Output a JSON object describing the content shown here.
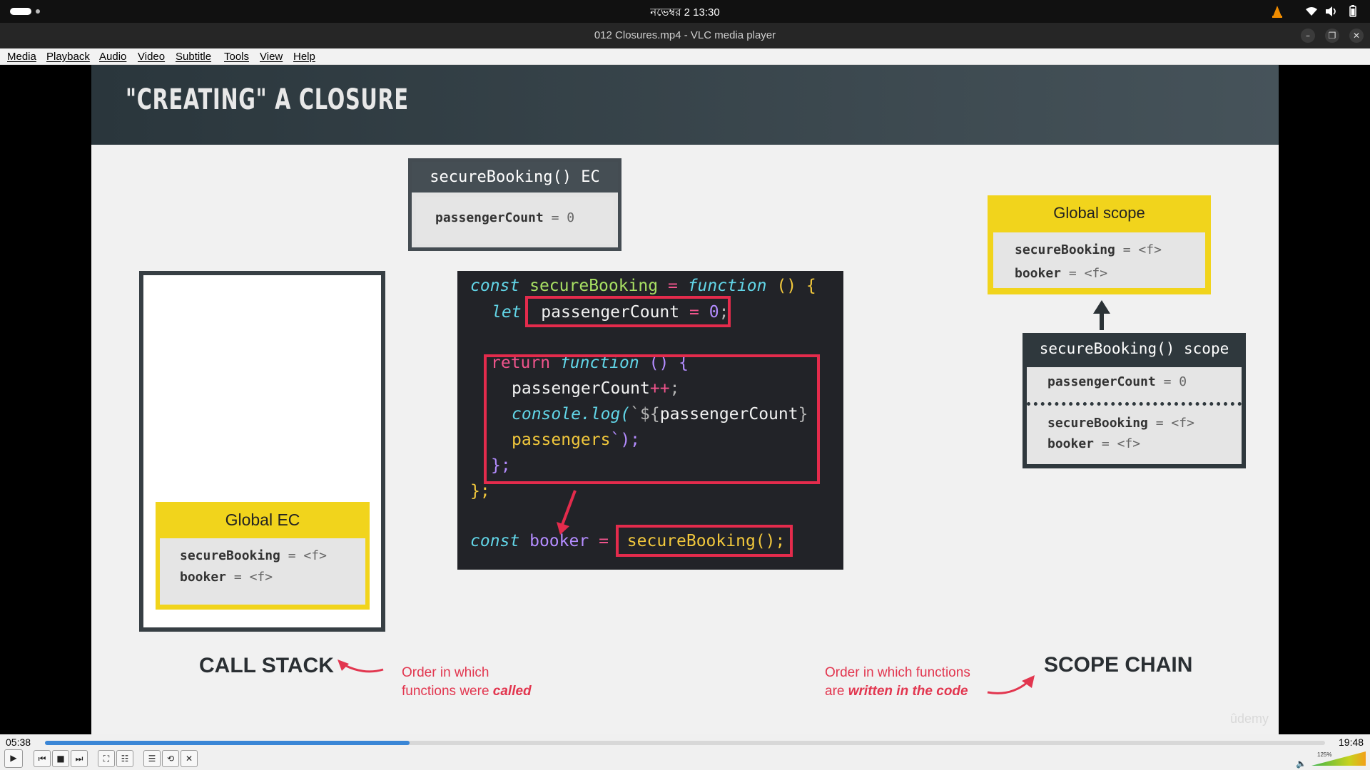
{
  "system": {
    "clock": "নভেম্বর 2  13:30",
    "tray_icons": [
      "vlc-cone-icon",
      "wifi-icon",
      "volume-icon",
      "battery-icon"
    ]
  },
  "window": {
    "title": "012 Closures.mp4 - VLC media player",
    "buttons": [
      "minimize",
      "maximize",
      "close"
    ]
  },
  "menu": {
    "items": [
      "Media",
      "Playback",
      "Audio",
      "Video",
      "Subtitle",
      "Tools",
      "View",
      "Help"
    ]
  },
  "slide": {
    "title": "\"CREATING\" A CLOSURE",
    "sb_ec": {
      "title": "secureBooking() EC",
      "var_name": "passengerCount",
      "eq": "=",
      "var_value": "0"
    },
    "global_ec": {
      "title": "Global EC",
      "rows": [
        {
          "name": "secureBooking",
          "eq": "=",
          "value": "<f>"
        },
        {
          "name": "booker",
          "eq": "=",
          "value": "<f>"
        }
      ]
    },
    "code": {
      "l1_const": "const",
      "l1_name": "secureBooking",
      "l1_eq": "=",
      "l1_function": "function",
      "l1_tail": "() {",
      "l2_let": "let",
      "l2_var": "passengerCount",
      "l2_eq": "=",
      "l2_val": "0",
      "l2_semi": ";",
      "l3_return": "return",
      "l3_function": "function",
      "l3_tail": "() {",
      "l4_var": "passengerCount",
      "l4_op": "++",
      "l4_semi": ";",
      "l5_console": "console",
      "l5_log": ".log(",
      "l5_tmpl": "`${",
      "l5_var": "passengerCount",
      "l5_close": "}",
      "l6_text": "passengers",
      "l6_end": "`);",
      "l7": "};",
      "l8": "};",
      "l9_const": "const",
      "l9_name": "booker",
      "l9_eq": "=",
      "l9_call": "secureBooking();"
    },
    "global_scope": {
      "title": "Global scope",
      "rows": [
        {
          "name": "secureBooking",
          "eq": "=",
          "value": "<f>"
        },
        {
          "name": "booker",
          "eq": "=",
          "value": "<f>"
        }
      ]
    },
    "sb_scope": {
      "title": "secureBooking() scope",
      "local_name": "passengerCount",
      "local_eq": "=",
      "local_value": "0",
      "rows": [
        {
          "name": "secureBooking",
          "eq": "=",
          "value": "<f>"
        },
        {
          "name": "booker",
          "eq": "=",
          "value": "<f>"
        }
      ]
    },
    "call_stack_label": "CALL STACK",
    "call_stack_note_1": "Order in which",
    "call_stack_note_2": "functions were",
    "call_stack_note_em": "called",
    "scope_chain_label": "SCOPE CHAIN",
    "scope_chain_note_1": "Order in which functions",
    "scope_chain_note_2": "are",
    "scope_chain_note_em": "written in the code",
    "watermark": "ûdemy"
  },
  "player": {
    "elapsed": "05:38",
    "total": "19:48",
    "progress": 0.285,
    "volume_label": "125%",
    "buttons": [
      "play",
      "previous",
      "stop",
      "next",
      "fullscreen",
      "extended-settings",
      "playlist",
      "loop",
      "random"
    ]
  },
  "colors": {
    "accent_yellow": "#f1d41c",
    "accent_red": "#e42b4c",
    "seek_blue": "#3a86d6"
  }
}
